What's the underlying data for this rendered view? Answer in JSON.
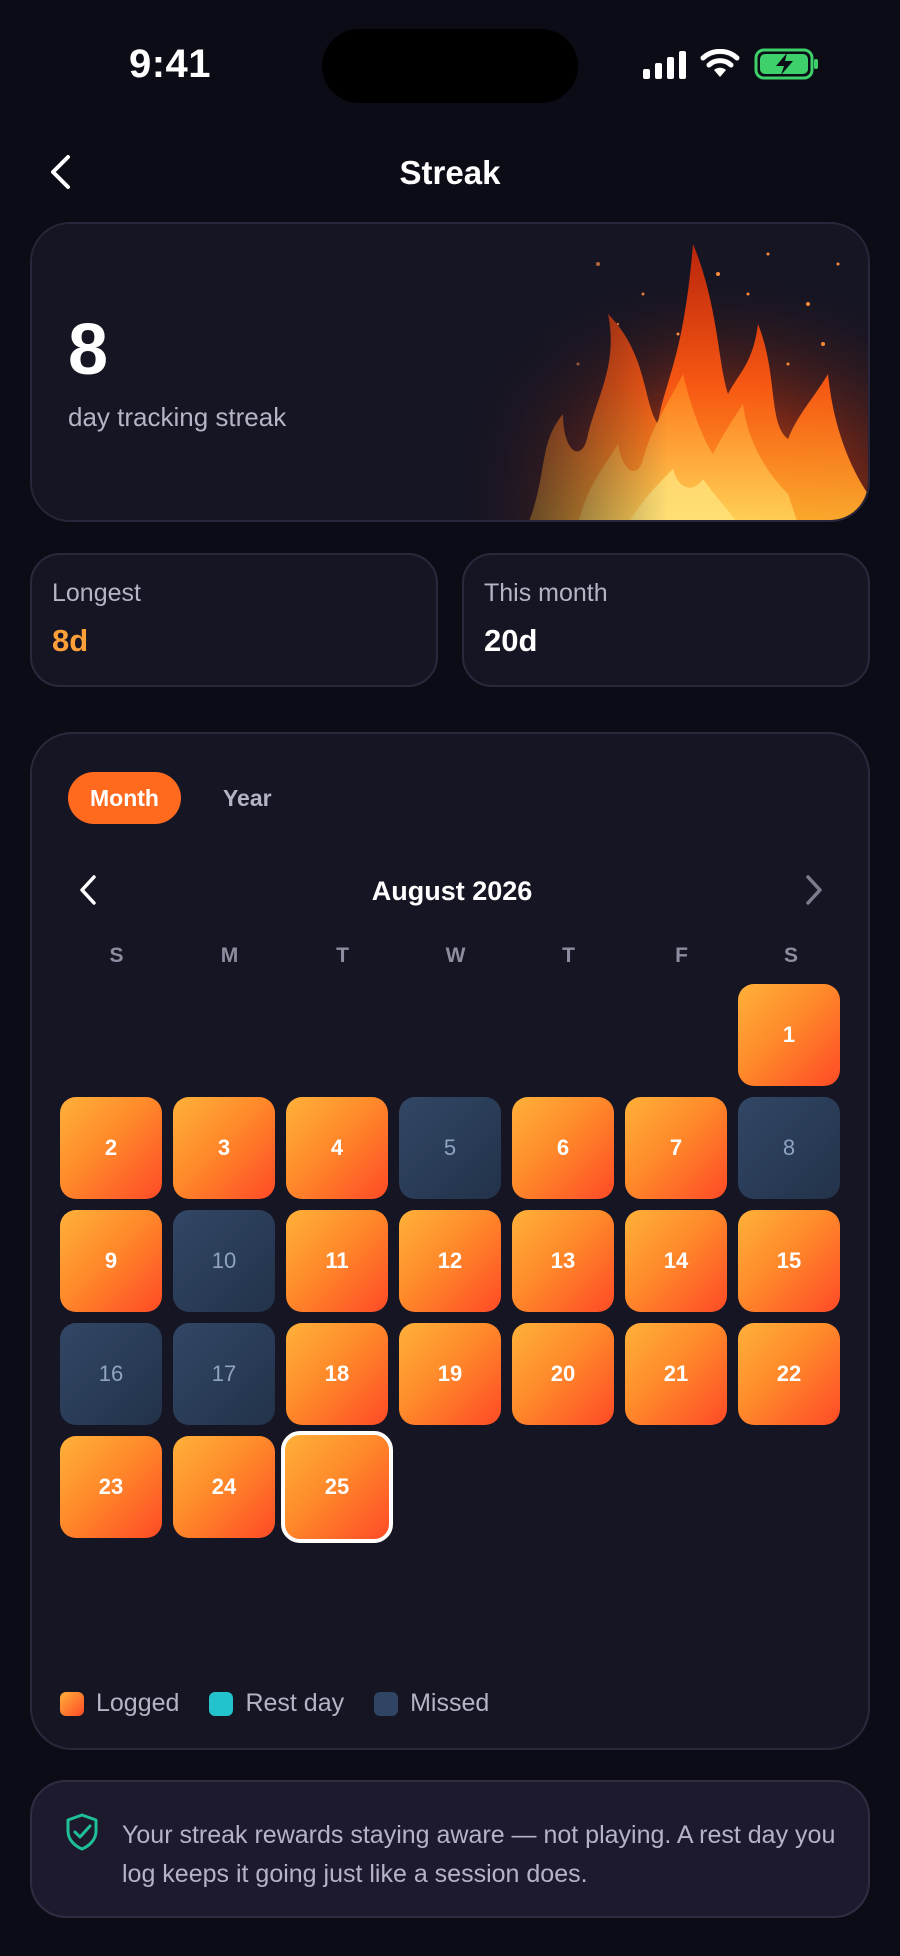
{
  "status_bar": {
    "time": "9:41"
  },
  "nav": {
    "title": "Streak"
  },
  "hero": {
    "streak_number": "8",
    "streak_label": "day tracking streak"
  },
  "stats": {
    "longest": {
      "label": "Longest",
      "value": "8d"
    },
    "this_month": {
      "label": "This month",
      "value": "20d"
    }
  },
  "calendar": {
    "tabs": [
      {
        "label": "Month",
        "active": true
      },
      {
        "label": "Year",
        "active": false
      }
    ],
    "month_label": "August 2026",
    "weekdays": [
      "S",
      "M",
      "T",
      "W",
      "T",
      "F",
      "S"
    ],
    "leading_blanks": 6,
    "days": [
      {
        "day": "1",
        "status": "logged"
      },
      {
        "day": "2",
        "status": "logged"
      },
      {
        "day": "3",
        "status": "logged"
      },
      {
        "day": "4",
        "status": "logged"
      },
      {
        "day": "5",
        "status": "missed"
      },
      {
        "day": "6",
        "status": "logged"
      },
      {
        "day": "7",
        "status": "logged"
      },
      {
        "day": "8",
        "status": "missed"
      },
      {
        "day": "9",
        "status": "logged"
      },
      {
        "day": "10",
        "status": "missed"
      },
      {
        "day": "11",
        "status": "logged"
      },
      {
        "day": "12",
        "status": "logged"
      },
      {
        "day": "13",
        "status": "logged"
      },
      {
        "day": "14",
        "status": "logged"
      },
      {
        "day": "15",
        "status": "logged"
      },
      {
        "day": "16",
        "status": "missed"
      },
      {
        "day": "17",
        "status": "missed"
      },
      {
        "day": "18",
        "status": "logged"
      },
      {
        "day": "19",
        "status": "logged"
      },
      {
        "day": "20",
        "status": "logged"
      },
      {
        "day": "21",
        "status": "logged"
      },
      {
        "day": "22",
        "status": "logged"
      },
      {
        "day": "23",
        "status": "logged"
      },
      {
        "day": "24",
        "status": "logged"
      },
      {
        "day": "25",
        "status": "logged",
        "today": true
      }
    ],
    "legend": [
      {
        "label": "Logged",
        "color": "#ff7a24"
      },
      {
        "label": "Rest day",
        "color": "#22c3cc"
      },
      {
        "label": "Missed",
        "color": "#2f4563"
      }
    ]
  },
  "info": {
    "icon": "shield-check-icon",
    "text": "Your streak rewards staying aware — not playing. A rest day you log keeps it going just like a session does."
  },
  "colors": {
    "accent": "#ff6a1f",
    "longest_value": "#ff9f3a",
    "shield": "#1fbf9a",
    "battery": "#3dd06b"
  }
}
